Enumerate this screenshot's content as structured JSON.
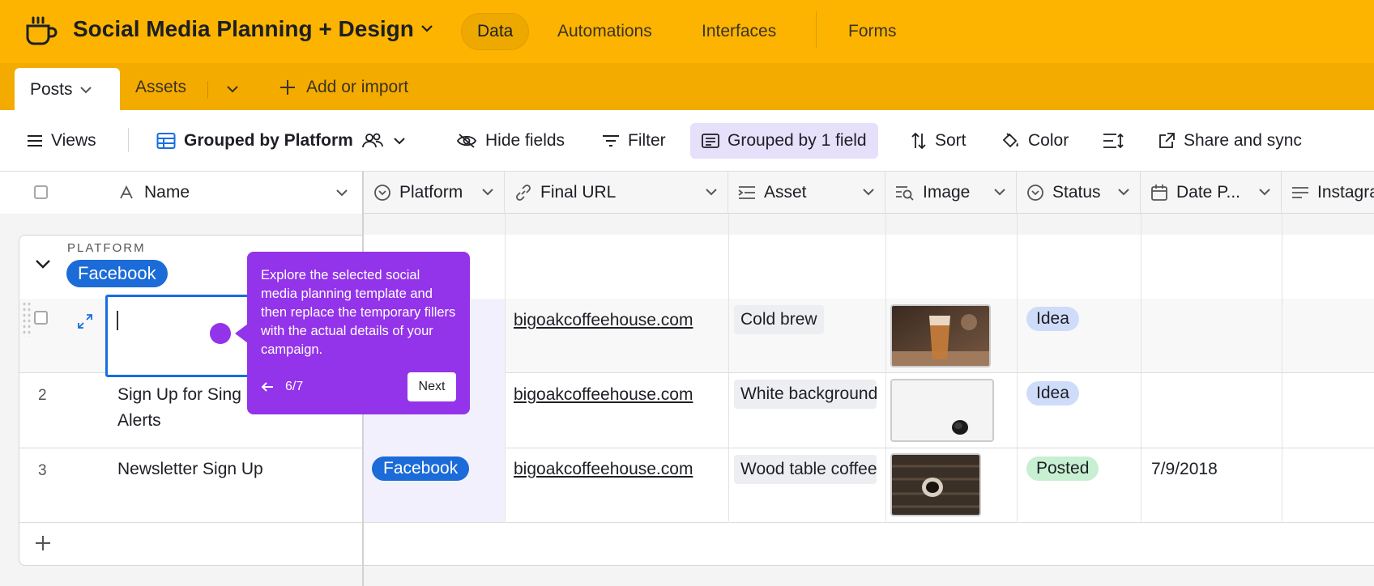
{
  "app": {
    "base_title": "Social Media Planning + Design",
    "nav": [
      {
        "label": "Data",
        "active": true
      },
      {
        "label": "Automations",
        "active": false
      },
      {
        "label": "Interfaces",
        "active": false
      },
      {
        "label": "Forms",
        "active": false
      }
    ]
  },
  "tables": {
    "active": "Posts",
    "other": "Assets",
    "add_label": "Add or import"
  },
  "toolbar": {
    "views": "Views",
    "view_name": "Grouped by Platform",
    "hide_fields": "Hide fields",
    "filter": "Filter",
    "grouped": "Grouped by 1 field",
    "sort": "Sort",
    "color": "Color",
    "share": "Share and sync"
  },
  "columns": {
    "name": "Name",
    "platform": "Platform",
    "final_url": "Final URL",
    "asset": "Asset",
    "image": "Image",
    "status": "Status",
    "date": "Date P...",
    "instagram": "Instagra"
  },
  "group": {
    "label": "PLATFORM",
    "value": "Facebook"
  },
  "rows": [
    {
      "num": "",
      "name": "",
      "platform": "",
      "url": "bigoakcoffeehouse.com",
      "asset": "Cold brew",
      "status": "Idea",
      "date": ""
    },
    {
      "num": "2",
      "name_line1": "Sign Up for Sing",
      "name_line2": "Alerts",
      "platform": "",
      "url": "bigoakcoffeehouse.com",
      "asset": "White background",
      "status": "Idea",
      "date": ""
    },
    {
      "num": "3",
      "name": "Newsletter Sign Up",
      "platform": "Facebook",
      "url": "bigoakcoffeehouse.com",
      "asset": "Wood table coffee",
      "status": "Posted",
      "date": "7/9/2018"
    }
  ],
  "tooltip": {
    "text": "Explore the selected social media planning template and then replace the temporary fillers with the actual details of your campaign.",
    "step": "6/7",
    "next": "Next"
  },
  "colors": {
    "appbar": "#fcb400",
    "accent": "#9333ea",
    "chip_blue": "#1b6bd8"
  }
}
